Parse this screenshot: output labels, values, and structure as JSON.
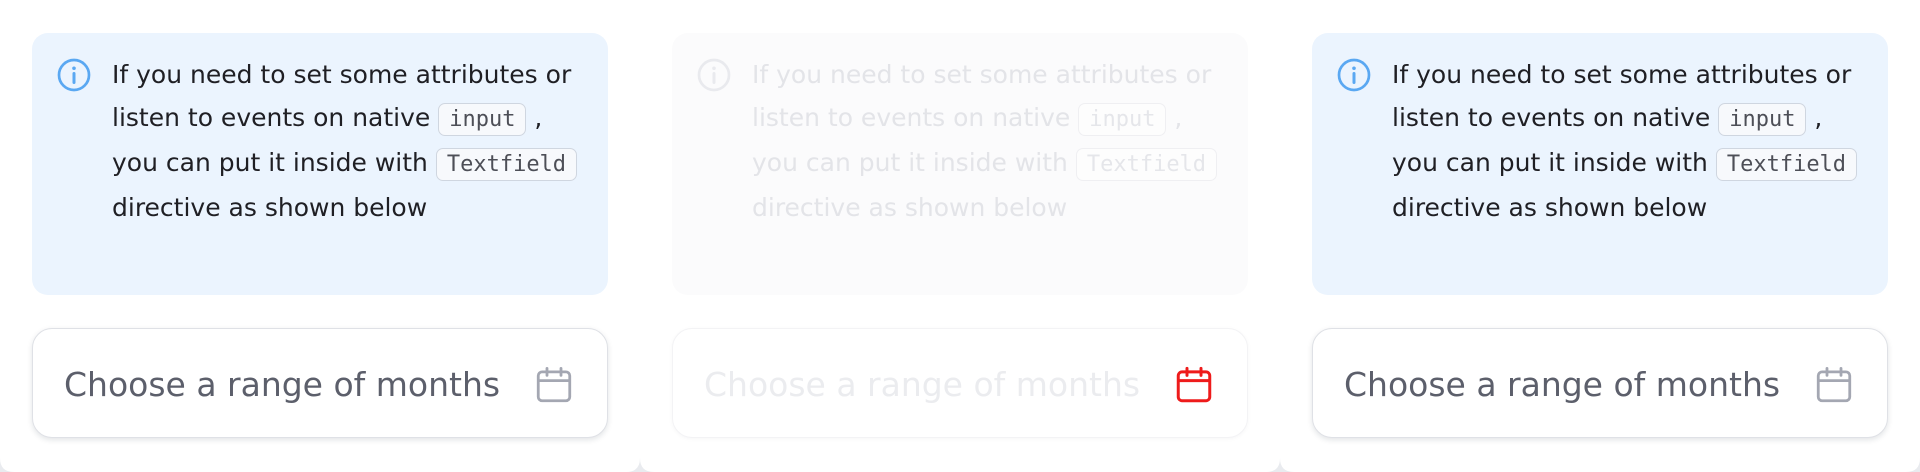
{
  "panels": [
    {
      "state": "default",
      "info": {
        "icon": "info-circle-icon",
        "text_before_input": "If you need to set some attributes or listen to events on native ",
        "code_input": "input",
        "text_after_input": " , you can put it inside with ",
        "code_textfield": "Textfield",
        "text_after_textfield": " directive as shown below"
      },
      "field": {
        "placeholder": "Choose a range of months",
        "icon": "calendar-icon"
      }
    },
    {
      "state": "disabled",
      "info": {
        "icon": "info-circle-icon",
        "text_before_input": "If you need to set some attributes or listen to events on native ",
        "code_input": "input",
        "text_after_input": " , you can put it inside with ",
        "code_textfield": "Textfield",
        "text_after_textfield": " directive as shown below"
      },
      "field": {
        "placeholder": "Choose a range of months",
        "icon": "calendar-icon"
      }
    },
    {
      "state": "default",
      "info": {
        "icon": "info-circle-icon",
        "text_before_input": "If you need to set some attributes or listen to events on native ",
        "code_input": "input",
        "text_after_input": " , you can put it inside with ",
        "code_textfield": "Textfield",
        "text_after_textfield": " directive as shown below"
      },
      "field": {
        "placeholder": "Choose a range of months",
        "icon": "calendar-icon"
      }
    }
  ],
  "colors": {
    "info_background": "#ebf4fe",
    "info_icon": "#5aa8f2",
    "calendar_icon_default": "#a4a7b2",
    "calendar_icon_disabled_panel": "#ee1b1b",
    "text_default": "#1f1f24",
    "placeholder_default": "#5c5f6b"
  }
}
